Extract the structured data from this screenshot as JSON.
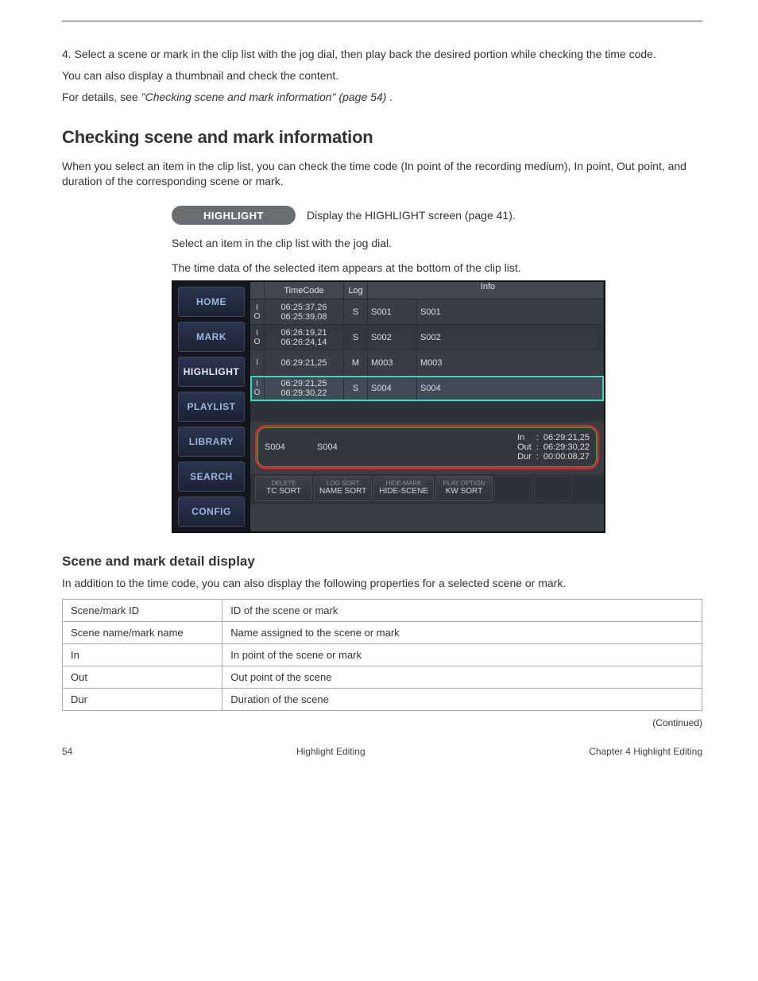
{
  "header": {},
  "intro": {
    "l1": "4. Select a scene or mark in the clip list with the jog dial, then play back the desired portion while checking the time code.",
    "l2": "You can also display a thumbnail and check the content.",
    "tip_pre": "For details, see ",
    "tip_link": "\"Checking scene and mark information\" (page 54)",
    "tip_post": "."
  },
  "section_title": "Checking scene and mark information",
  "overview": "When you select an item in the clip list, you can check the time code (In point of the recording medium), In point, Out point, and duration of the corresponding scene or mark.",
  "steps": {
    "pill1": {
      "pill": "HIGHLIGHT",
      "text": "Display the HIGHLIGHT screen (page 41)."
    },
    "instr2": "Select an item in the clip list with the jog dial.",
    "caption": "The time data of the selected item appears at the bottom of the clip list."
  },
  "screenshot": {
    "nav": [
      "HOME",
      "MARK",
      "HIGHLIGHT",
      "PLAYLIST",
      "LIBRARY",
      "SEARCH",
      "CONFIG"
    ],
    "nav_active_index": 2,
    "columns": {
      "tc": "TimeCode",
      "log": "Log",
      "info": "Info"
    },
    "rows": [
      {
        "io": [
          "I",
          "O"
        ],
        "tc": [
          "06:25:37,26",
          "06:25:39,08"
        ],
        "log": "S",
        "id": "S001",
        "info": "S001"
      },
      {
        "io": [
          "I",
          "O"
        ],
        "tc": [
          "06:26:19,21",
          "06:26:24,14"
        ],
        "log": "S",
        "id": "S002",
        "info": "S002"
      },
      {
        "io": [
          "I"
        ],
        "tc": [
          "06:29:21,25"
        ],
        "log": "M",
        "id": "M003",
        "info": "M003"
      },
      {
        "io": [
          "I",
          "O"
        ],
        "tc": [
          "06:29:21,25",
          "06:29:30,22"
        ],
        "log": "S",
        "id": "S004",
        "info": "S004",
        "selected": true
      }
    ],
    "detail": {
      "id": "S004",
      "label": "S004",
      "In": "06:29:21,25",
      "Out": "06:29:30,22",
      "Dur": "00:00:08,27"
    },
    "buttons": [
      {
        "top": "DELETE",
        "bottom": "TC SORT"
      },
      {
        "top": "LOG SORT",
        "bottom": "NAME SORT"
      },
      {
        "top": "HIDE-MARK",
        "bottom": "HIDE-SCENE"
      },
      {
        "top": "PLAY OPTION",
        "bottom": "KW SORT"
      }
    ]
  },
  "detail_section": {
    "title": "Scene and mark detail display",
    "p": "In addition to the time code, you can also display the following properties for a selected scene or mark.",
    "rows": [
      {
        "k": "Scene/mark ID",
        "v": "ID of the scene or mark"
      },
      {
        "k": "Scene name/mark name",
        "v": "Name assigned to the scene or mark"
      },
      {
        "k": "In",
        "v": "In point of the scene or mark"
      },
      {
        "k": "Out",
        "v": "Out point of the scene"
      },
      {
        "k": "Dur",
        "v": "Duration of the scene"
      }
    ],
    "continued_label": "(Continued)"
  },
  "footer": {
    "left": "54",
    "center": "Highlight Editing",
    "right": "Chapter 4  Highlight Editing"
  },
  "labels": {
    "k_in": "In",
    "k_out": "Out",
    "k_dur": "Dur",
    "colon": ":"
  }
}
